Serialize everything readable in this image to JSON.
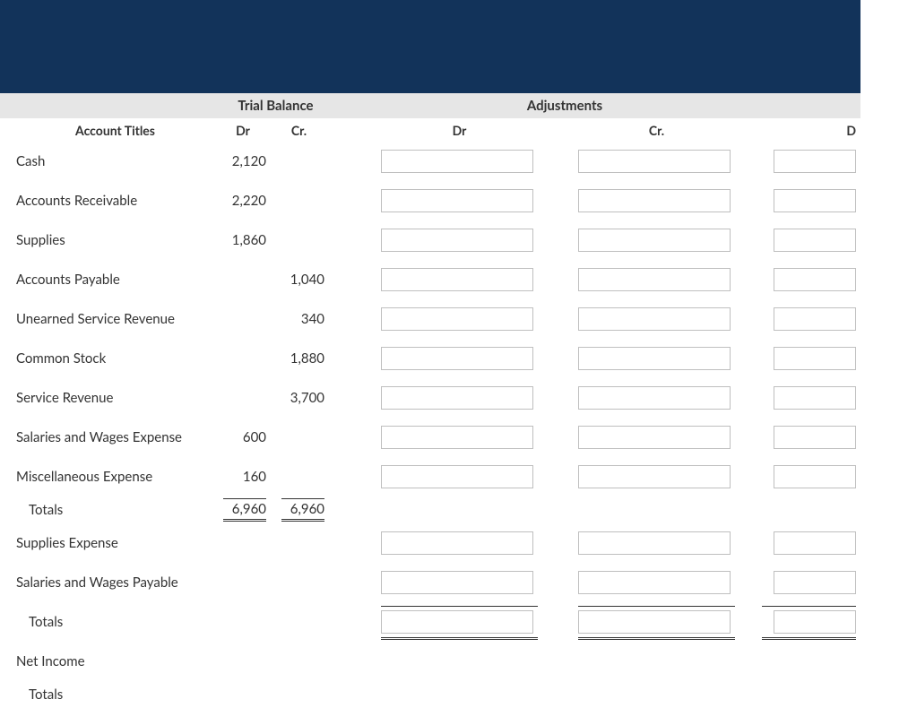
{
  "sections": {
    "trial_balance": "Trial Balance",
    "adjustments": "Adjustments"
  },
  "columns": {
    "account_titles": "Account Titles",
    "dr": "Dr",
    "cr": "Cr.",
    "extra": "D"
  },
  "rows": [
    {
      "title": "Cash",
      "tb_dr": "2,120",
      "tb_cr": "",
      "has_inputs": true,
      "indent": false
    },
    {
      "title": "Accounts Receivable",
      "tb_dr": "2,220",
      "tb_cr": "",
      "has_inputs": true,
      "indent": false
    },
    {
      "title": "Supplies",
      "tb_dr": "1,860",
      "tb_cr": "",
      "has_inputs": true,
      "indent": false
    },
    {
      "title": "Accounts Payable",
      "tb_dr": "",
      "tb_cr": "1,040",
      "has_inputs": true,
      "indent": false
    },
    {
      "title": "Unearned Service Revenue",
      "tb_dr": "",
      "tb_cr": "340",
      "has_inputs": true,
      "indent": false
    },
    {
      "title": "Common Stock",
      "tb_dr": "",
      "tb_cr": "1,880",
      "has_inputs": true,
      "indent": false
    },
    {
      "title": "Service Revenue",
      "tb_dr": "",
      "tb_cr": "3,700",
      "has_inputs": true,
      "indent": false
    },
    {
      "title": "Salaries and Wages Expense",
      "tb_dr": "600",
      "tb_cr": "",
      "has_inputs": true,
      "indent": false
    },
    {
      "title": "Miscellaneous Expense",
      "tb_dr": "160",
      "tb_cr": "",
      "has_inputs": true,
      "indent": false
    }
  ],
  "totals1": {
    "title": "Totals",
    "tb_dr": "6,960",
    "tb_cr": "6,960"
  },
  "extra_rows": [
    {
      "title": "Supplies Expense",
      "has_inputs": true,
      "indent": false,
      "border": "none"
    },
    {
      "title": "Salaries and Wages Payable",
      "has_inputs": true,
      "indent": false,
      "border": "bottom-single"
    }
  ],
  "totals2": {
    "title": "Totals"
  },
  "net_income": {
    "title": "Net Income"
  },
  "totals3": {
    "title": "Totals"
  }
}
